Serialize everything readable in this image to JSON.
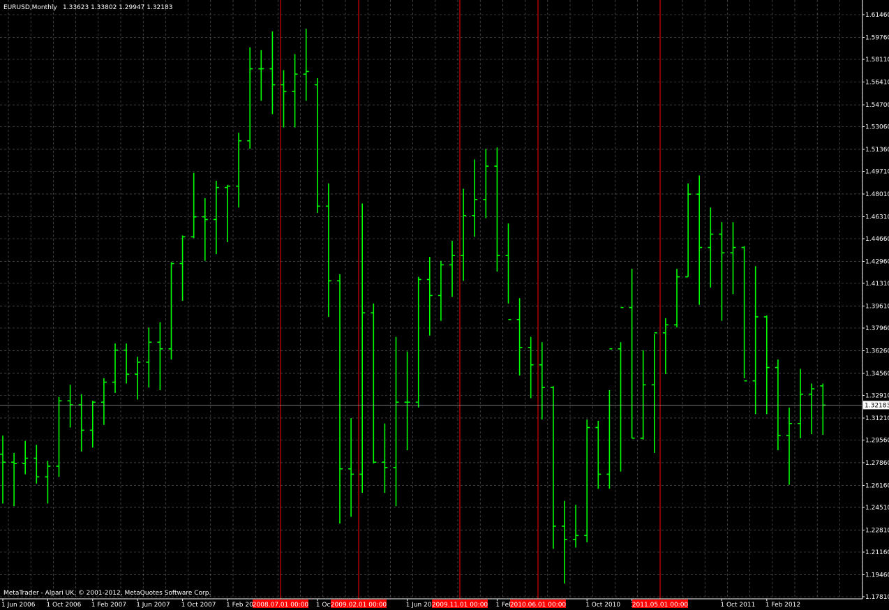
{
  "header": {
    "symbol": "EURUSD,Monthly",
    "ohlc": "1.33623 1.33802 1.29947 1.32183"
  },
  "footer": {
    "copyright": "MetaTrader - Alpari UK, © 2001-2012, MetaQuotes Software Corp."
  },
  "current_price": "1.32183",
  "colors": {
    "background": "#000000",
    "up_bar": "#00ff00",
    "down_bar": "#00ff00",
    "grid": "#c0c0c0",
    "vline": "#ff0000",
    "vline_label_bg": "#ff0000",
    "bidline": "#c0c0c0"
  },
  "chart_data": {
    "type": "ohlc",
    "title": "EURUSD,Monthly",
    "ylim": [
      1.1781,
      1.6146
    ],
    "price_ticks": [
      "1.61460",
      "1.59760",
      "1.58110",
      "1.56410",
      "1.54700",
      "1.53060",
      "1.51360",
      "1.49710",
      "1.48010",
      "1.46310",
      "1.44660",
      "1.42960",
      "1.41310",
      "1.39610",
      "1.37960",
      "1.36260",
      "1.34560",
      "1.32910",
      "1.31210",
      "1.29560",
      "1.27860",
      "1.26160",
      "1.24510",
      "1.22810",
      "1.21160",
      "1.19460",
      "1.17810"
    ],
    "time_labels": [
      {
        "text": "1 Jun 2006",
        "bar": 0
      },
      {
        "text": "1 Oct 2006",
        "bar": 4
      },
      {
        "text": "1 Feb 2007",
        "bar": 8
      },
      {
        "text": "1 Jun 2007",
        "bar": 12
      },
      {
        "text": "1 Oct 2007",
        "bar": 16
      },
      {
        "text": "1 Feb 200",
        "bar": 20
      },
      {
        "text": "1 Oct",
        "bar": 28
      },
      {
        "text": "1 Jun 200",
        "bar": 36
      },
      {
        "text": "1 Feb",
        "bar": 44
      },
      {
        "text": "1 Oct 2010",
        "bar": 52
      },
      {
        "text": "1",
        "bar": 56
      },
      {
        "text": "1 Oct 2011",
        "bar": 64
      },
      {
        "text": "1 Feb 2012",
        "bar": 68
      }
    ],
    "vlines": [
      {
        "label": "2008.07.01 00:00",
        "bar": 25
      },
      {
        "label": "2009.02.01 00:00",
        "bar": 32
      },
      {
        "label": "2009.11.01 00:00",
        "bar": 41
      },
      {
        "label": "2010.06.01 00:00",
        "bar": 48
      },
      {
        "label": "2011.05.01 00:00",
        "bar": 59
      }
    ],
    "bars": [
      {
        "o": 1.285,
        "h": 1.299,
        "l": 1.248,
        "c": 1.279
      },
      {
        "o": 1.279,
        "h": 1.286,
        "l": 1.246,
        "c": 1.278
      },
      {
        "o": 1.278,
        "h": 1.295,
        "l": 1.27,
        "c": 1.282
      },
      {
        "o": 1.282,
        "h": 1.292,
        "l": 1.263,
        "c": 1.268
      },
      {
        "o": 1.268,
        "h": 1.28,
        "l": 1.248,
        "c": 1.276
      },
      {
        "o": 1.276,
        "h": 1.328,
        "l": 1.268,
        "c": 1.325
      },
      {
        "o": 1.325,
        "h": 1.337,
        "l": 1.305,
        "c": 1.322
      },
      {
        "o": 1.322,
        "h": 1.33,
        "l": 1.287,
        "c": 1.303
      },
      {
        "o": 1.303,
        "h": 1.325,
        "l": 1.29,
        "c": 1.324
      },
      {
        "o": 1.324,
        "h": 1.342,
        "l": 1.307,
        "c": 1.339
      },
      {
        "o": 1.339,
        "h": 1.368,
        "l": 1.331,
        "c": 1.363
      },
      {
        "o": 1.363,
        "h": 1.368,
        "l": 1.338,
        "c": 1.345
      },
      {
        "o": 1.345,
        "h": 1.358,
        "l": 1.326,
        "c": 1.354
      },
      {
        "o": 1.354,
        "h": 1.38,
        "l": 1.335,
        "c": 1.369
      },
      {
        "o": 1.369,
        "h": 1.384,
        "l": 1.333,
        "c": 1.364
      },
      {
        "o": 1.364,
        "h": 1.429,
        "l": 1.356,
        "c": 1.428
      },
      {
        "o": 1.428,
        "h": 1.449,
        "l": 1.4,
        "c": 1.448
      },
      {
        "o": 1.448,
        "h": 1.496,
        "l": 1.447,
        "c": 1.463
      },
      {
        "o": 1.463,
        "h": 1.477,
        "l": 1.43,
        "c": 1.461
      },
      {
        "o": 1.461,
        "h": 1.49,
        "l": 1.435,
        "c": 1.485
      },
      {
        "o": 1.485,
        "h": 1.487,
        "l": 1.444,
        "c": 1.486
      },
      {
        "o": 1.486,
        "h": 1.526,
        "l": 1.47,
        "c": 1.52
      },
      {
        "o": 1.52,
        "h": 1.59,
        "l": 1.514,
        "c": 1.574
      },
      {
        "o": 1.574,
        "h": 1.588,
        "l": 1.55,
        "c": 1.574
      },
      {
        "o": 1.574,
        "h": 1.602,
        "l": 1.54,
        "c": 1.562
      },
      {
        "o": 1.562,
        "h": 1.573,
        "l": 1.53,
        "c": 1.557
      },
      {
        "o": 1.557,
        "h": 1.585,
        "l": 1.53,
        "c": 1.57
      },
      {
        "o": 1.57,
        "h": 1.604,
        "l": 1.55,
        "c": 1.572
      },
      {
        "o": 1.562,
        "h": 1.567,
        "l": 1.466,
        "c": 1.471
      },
      {
        "o": 1.471,
        "h": 1.488,
        "l": 1.388,
        "c": 1.415
      },
      {
        "o": 1.415,
        "h": 1.42,
        "l": 1.233,
        "c": 1.274
      },
      {
        "o": 1.274,
        "h": 1.312,
        "l": 1.238,
        "c": 1.27
      },
      {
        "o": 1.27,
        "h": 1.473,
        "l": 1.256,
        "c": 1.391
      },
      {
        "o": 1.391,
        "h": 1.398,
        "l": 1.278,
        "c": 1.279
      },
      {
        "o": 1.279,
        "h": 1.308,
        "l": 1.256,
        "c": 1.275
      },
      {
        "o": 1.275,
        "h": 1.373,
        "l": 1.246,
        "c": 1.324
      },
      {
        "o": 1.324,
        "h": 1.362,
        "l": 1.288,
        "c": 1.324
      },
      {
        "o": 1.324,
        "h": 1.418,
        "l": 1.32,
        "c": 1.416
      },
      {
        "o": 1.416,
        "h": 1.433,
        "l": 1.374,
        "c": 1.404
      },
      {
        "o": 1.404,
        "h": 1.43,
        "l": 1.385,
        "c": 1.427
      },
      {
        "o": 1.427,
        "h": 1.445,
        "l": 1.403,
        "c": 1.434
      },
      {
        "o": 1.434,
        "h": 1.484,
        "l": 1.415,
        "c": 1.464
      },
      {
        "o": 1.464,
        "h": 1.506,
        "l": 1.448,
        "c": 1.476
      },
      {
        "o": 1.476,
        "h": 1.514,
        "l": 1.462,
        "c": 1.501
      },
      {
        "o": 1.501,
        "h": 1.515,
        "l": 1.422,
        "c": 1.434
      },
      {
        "o": 1.434,
        "h": 1.458,
        "l": 1.398,
        "c": 1.386
      },
      {
        "o": 1.386,
        "h": 1.402,
        "l": 1.344,
        "c": 1.365
      },
      {
        "o": 1.365,
        "h": 1.373,
        "l": 1.327,
        "c": 1.352
      },
      {
        "o": 1.352,
        "h": 1.369,
        "l": 1.311,
        "c": 1.335
      },
      {
        "o": 1.335,
        "h": 1.336,
        "l": 1.214,
        "c": 1.231
      },
      {
        "o": 1.231,
        "h": 1.25,
        "l": 1.188,
        "c": 1.221
      },
      {
        "o": 1.221,
        "h": 1.247,
        "l": 1.215,
        "c": 1.224
      },
      {
        "o": 1.224,
        "h": 1.311,
        "l": 1.219,
        "c": 1.305
      },
      {
        "o": 1.305,
        "h": 1.31,
        "l": 1.259,
        "c": 1.27
      },
      {
        "o": 1.27,
        "h": 1.333,
        "l": 1.259,
        "c": 1.364
      },
      {
        "o": 1.364,
        "h": 1.369,
        "l": 1.272,
        "c": 1.395
      },
      {
        "o": 1.395,
        "h": 1.424,
        "l": 1.297,
        "c": 1.297
      },
      {
        "o": 1.297,
        "h": 1.363,
        "l": 1.296,
        "c": 1.337
      },
      {
        "o": 1.337,
        "h": 1.375,
        "l": 1.286,
        "c": 1.376
      },
      {
        "o": 1.376,
        "h": 1.387,
        "l": 1.345,
        "c": 1.382
      },
      {
        "o": 1.382,
        "h": 1.424,
        "l": 1.38,
        "c": 1.418
      },
      {
        "o": 1.418,
        "h": 1.488,
        "l": 1.418,
        "c": 1.48
      },
      {
        "o": 1.48,
        "h": 1.494,
        "l": 1.397,
        "c": 1.44
      },
      {
        "o": 1.44,
        "h": 1.47,
        "l": 1.41,
        "c": 1.45
      },
      {
        "o": 1.45,
        "h": 1.459,
        "l": 1.385,
        "c": 1.436
      },
      {
        "o": 1.436,
        "h": 1.459,
        "l": 1.405,
        "c": 1.44
      },
      {
        "o": 1.44,
        "h": 1.441,
        "l": 1.342,
        "c": 1.34
      },
      {
        "o": 1.34,
        "h": 1.426,
        "l": 1.315,
        "c": 1.388
      },
      {
        "o": 1.388,
        "h": 1.389,
        "l": 1.315,
        "c": 1.35
      },
      {
        "o": 1.35,
        "h": 1.356,
        "l": 1.288,
        "c": 1.299
      },
      {
        "o": 1.299,
        "h": 1.32,
        "l": 1.262,
        "c": 1.308
      },
      {
        "o": 1.308,
        "h": 1.349,
        "l": 1.297,
        "c": 1.33
      },
      {
        "o": 1.33,
        "h": 1.338,
        "l": 1.3,
        "c": 1.334
      },
      {
        "o": 1.3362,
        "h": 1.338,
        "l": 1.2995,
        "c": 1.3218
      }
    ]
  }
}
